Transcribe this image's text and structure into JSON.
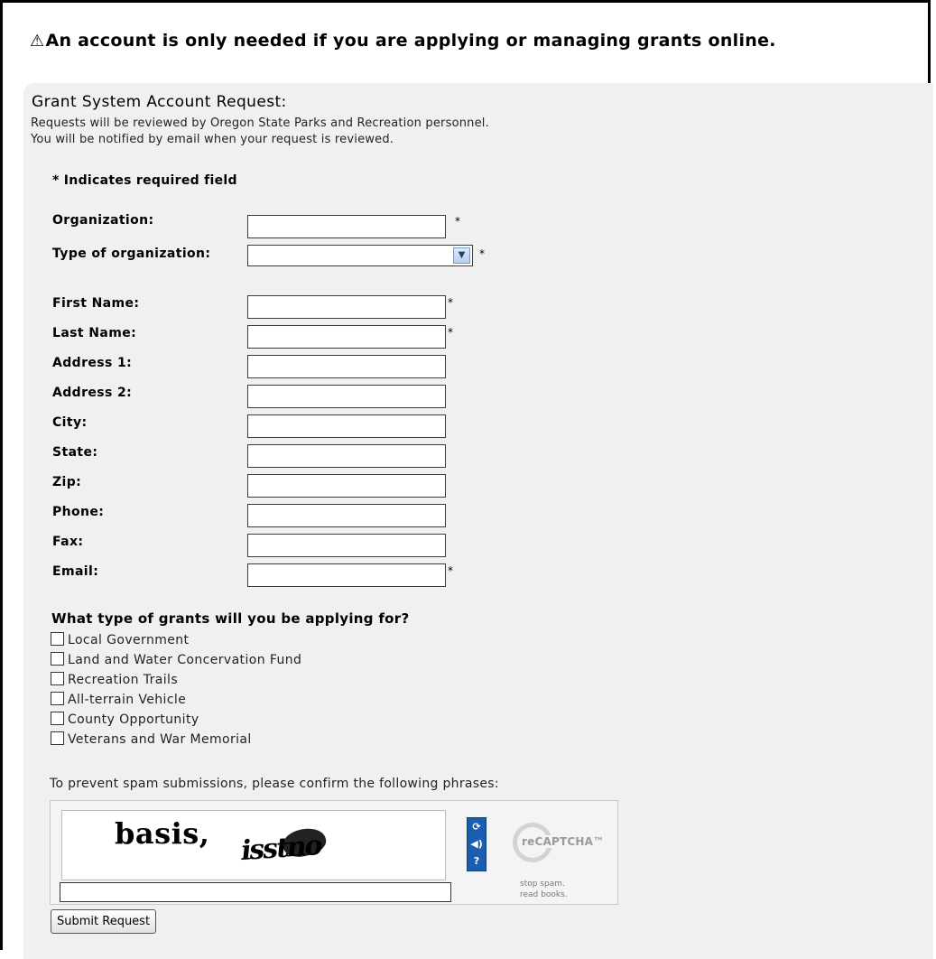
{
  "notice": {
    "icon": "warning-triangle-icon",
    "glyph": "⚠",
    "text": "An account is only needed if you are applying or managing grants online."
  },
  "form": {
    "title": "Grant System Account Request:",
    "desc_line1": "Requests will be reviewed by Oregon State Parks and Recreation personnel.",
    "desc_line2": "You will be notified by email when your request is reviewed.",
    "required_note": "* Indicates required field",
    "required_marker": "*",
    "fields": {
      "organization": {
        "label": "Organization:",
        "value": ""
      },
      "org_type": {
        "label": "Type of organization:",
        "value": ""
      },
      "first_name": {
        "label": "First Name:",
        "value": ""
      },
      "last_name": {
        "label": "Last Name:",
        "value": ""
      },
      "address1": {
        "label": "Address 1:",
        "value": ""
      },
      "address2": {
        "label": "Address 2:",
        "value": ""
      },
      "city": {
        "label": "City:",
        "value": ""
      },
      "state": {
        "label": "State:",
        "value": ""
      },
      "zip": {
        "label": "Zip:",
        "value": ""
      },
      "phone": {
        "label": "Phone:",
        "value": ""
      },
      "fax": {
        "label": "Fax:",
        "value": ""
      },
      "email": {
        "label": "Email:",
        "value": ""
      }
    },
    "grants_question": "What type of grants will you be applying for?",
    "grant_options": [
      "Local Government",
      "Land and Water Concervation Fund",
      "Recreation Trails",
      "All-terrain Vehicle",
      "County Opportunity",
      "Veterans and War Memorial"
    ],
    "spam_prompt": "To prevent spam submissions, please confirm the following phrases:",
    "captcha": {
      "word1": "basis,",
      "word2": "isstno",
      "buttons": {
        "refresh": "⟳",
        "audio": "◀)",
        "help": "?"
      },
      "logo_text": "reCAPTCHA™",
      "tagline1": "stop spam.",
      "tagline2": "read books."
    },
    "submit_label": "Submit Request"
  }
}
